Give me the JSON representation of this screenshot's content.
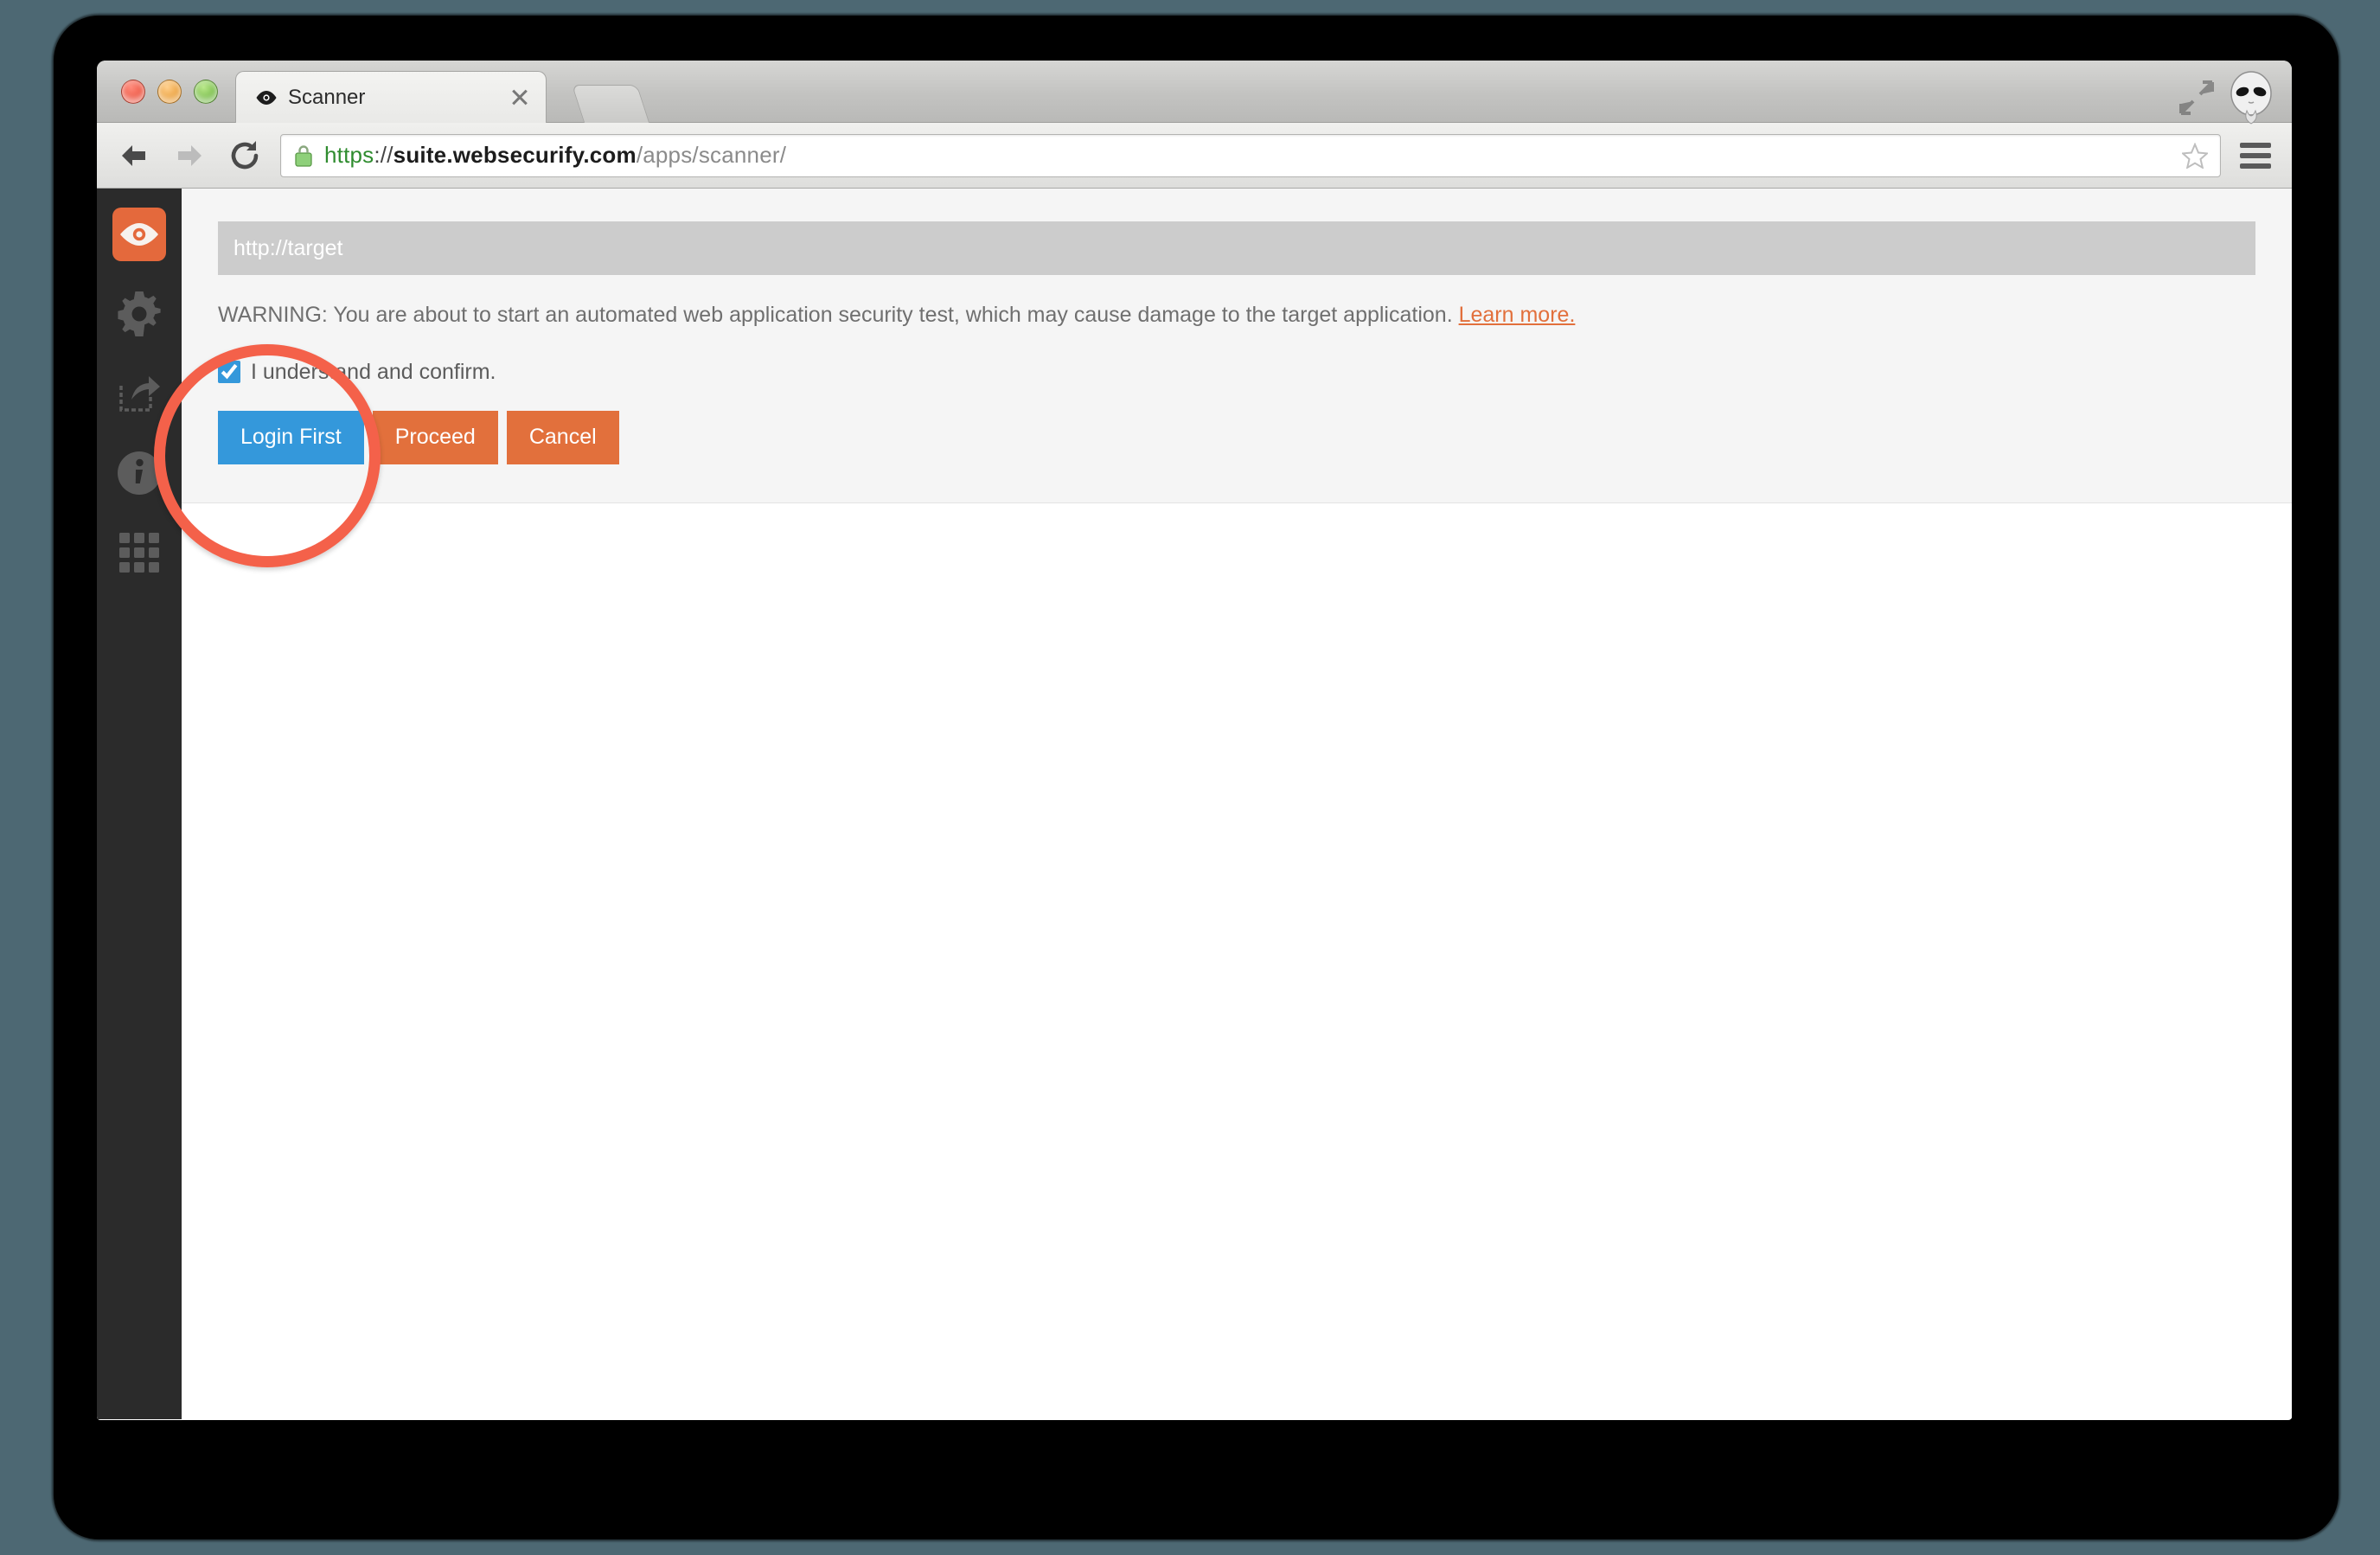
{
  "window": {
    "traffic_lights": [
      "close",
      "minimize",
      "maximize"
    ],
    "fullscreen_icon": "fullscreen-arrows-icon",
    "avatar_icon": "alien-avatar-icon"
  },
  "tabs": [
    {
      "title": "Scanner",
      "favicon": "eye-icon",
      "close_icon": "close-icon",
      "active": true
    }
  ],
  "new_tab": {
    "label": "",
    "icon": "new-tab-icon"
  },
  "toolbar": {
    "back_icon": "back-arrow-icon",
    "forward_icon": "forward-arrow-icon",
    "reload_icon": "reload-icon",
    "lock_icon": "padlock-icon",
    "star_icon": "star-icon",
    "menu_icon": "hamburger-menu-icon",
    "url": {
      "scheme": "https",
      "separator": "://",
      "host": "suite.websecurify.com",
      "path": "/apps/scanner/",
      "full": "https://suite.websecurify.com/apps/scanner/"
    }
  },
  "sidebar": {
    "items": [
      {
        "name": "scanner",
        "icon": "eye-icon",
        "active": true
      },
      {
        "name": "settings",
        "icon": "gear-icon",
        "active": false
      },
      {
        "name": "export",
        "icon": "share-export-icon",
        "active": false
      },
      {
        "name": "info",
        "icon": "info-circle-icon",
        "active": false
      },
      {
        "name": "apps",
        "icon": "grid-apps-icon",
        "active": false
      }
    ]
  },
  "scanner": {
    "target_input": {
      "value": "",
      "placeholder": "http://target"
    },
    "warning": {
      "text": "WARNING: You are about to start an automated web application security test, which may cause damage to the target application. ",
      "link_text": "Learn more."
    },
    "confirm": {
      "label": "I understand and confirm.",
      "checked": true
    },
    "buttons": [
      {
        "label": "Login First",
        "style": "primary"
      },
      {
        "label": "Proceed",
        "style": "danger"
      },
      {
        "label": "Cancel",
        "style": "danger"
      }
    ]
  },
  "annotation": {
    "shape": "circle",
    "color": "#f4614a",
    "targets": "login-first-button"
  },
  "colors": {
    "accent_orange": "#e2703c",
    "primary_blue": "#3498db",
    "sidebar_dark": "#2b2b2b",
    "panel_grey": "#f5f5f5",
    "input_grey": "#cccccc",
    "desktop_teal": "#4d6873",
    "annotation_red": "#f4614a"
  }
}
